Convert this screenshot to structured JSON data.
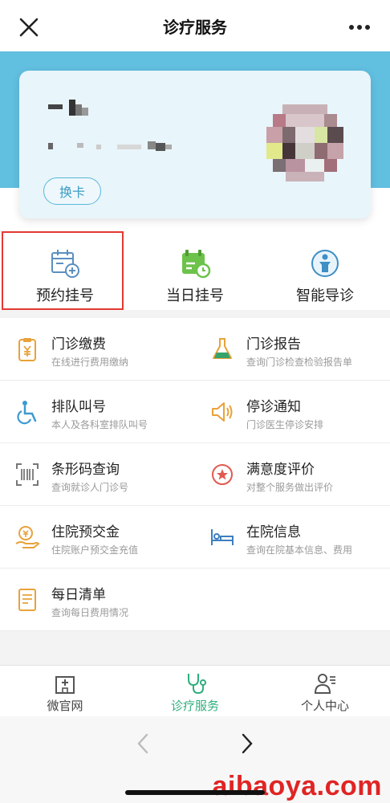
{
  "header": {
    "title": "诊疗服务"
  },
  "card": {
    "switch_label": "换卡"
  },
  "quick_actions": [
    {
      "label": "预约挂号",
      "icon": "calendar-plus-icon",
      "color": "#5a8fbf"
    },
    {
      "label": "当日挂号",
      "icon": "calendar-clock-icon",
      "color": "#6cc24a"
    },
    {
      "label": "智能导诊",
      "icon": "guide-person-icon",
      "color": "#3d8fc4"
    }
  ],
  "services": [
    {
      "title": "门诊缴费",
      "subtitle": "在线进行费用缴纳",
      "icon": "payment-yuan-icon"
    },
    {
      "title": "门诊报告",
      "subtitle": "查询门诊检查检验报告单",
      "icon": "flask-icon"
    },
    {
      "title": "排队叫号",
      "subtitle": "本人及各科室排队叫号",
      "icon": "wheelchair-icon"
    },
    {
      "title": "停诊通知",
      "subtitle": "门诊医生停诊安排",
      "icon": "speaker-icon"
    },
    {
      "title": "条形码查询",
      "subtitle": "查询就诊人门诊号",
      "icon": "barcode-icon"
    },
    {
      "title": "满意度评价",
      "subtitle": "对整个服务做出评价",
      "icon": "star-badge-icon"
    },
    {
      "title": "住院预交金",
      "subtitle": "住院账户预交金充值",
      "icon": "deposit-hand-icon"
    },
    {
      "title": "在院信息",
      "subtitle": "查询在院基本信息、费用",
      "icon": "bed-icon"
    },
    {
      "title": "每日清单",
      "subtitle": "查询每日费用情况",
      "icon": "list-doc-icon"
    }
  ],
  "tabs": [
    {
      "label": "微官网",
      "icon": "hospital-icon",
      "active": false
    },
    {
      "label": "诊疗服务",
      "icon": "stethoscope-icon",
      "active": true
    },
    {
      "label": "个人中心",
      "icon": "user-profile-icon",
      "active": false
    }
  ],
  "watermark": "aibaoya.com",
  "colors": {
    "accent_green": "#2eaf7d",
    "banner_blue": "#61bfe0",
    "highlight_red": "#e23a32",
    "icon_orange": "#e8a23a"
  }
}
